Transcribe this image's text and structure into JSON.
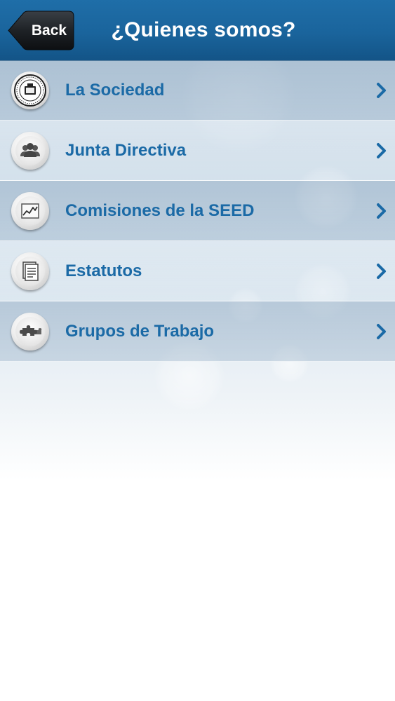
{
  "navbar": {
    "back_label": "Back",
    "title": "¿Quienes somos?"
  },
  "menu": {
    "items": [
      {
        "label": "La Sociedad",
        "icon": "seal-icon"
      },
      {
        "label": "Junta Directiva",
        "icon": "people-icon"
      },
      {
        "label": "Comisiones de la SEED",
        "icon": "chart-icon"
      },
      {
        "label": "Estatutos",
        "icon": "document-icon"
      },
      {
        "label": "Grupos de Trabajo",
        "icon": "puzzle-icon"
      }
    ]
  },
  "colors": {
    "navbar": "#1a649c",
    "label": "#1b6aa6",
    "chevron": "#1b6aa6"
  }
}
